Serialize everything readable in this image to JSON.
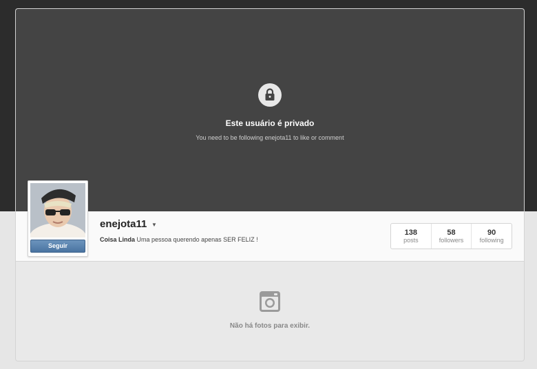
{
  "banner": {
    "title": "Este usuário é privado",
    "subtitle": "You need to be following enejota11 to like or comment"
  },
  "profile": {
    "username": "enejota11",
    "bio_name": "Coisa Linda",
    "bio_text": "Uma pessoa querendo apenas SER FELIZ !",
    "follow_label": "Seguir"
  },
  "stats": [
    {
      "value": "138",
      "label": "posts"
    },
    {
      "value": "58",
      "label": "followers"
    },
    {
      "value": "90",
      "label": "following"
    }
  ],
  "empty_state": {
    "message": "Não há fotos para exibir."
  },
  "colors": {
    "banner_bg": "#444444",
    "follow_button": "#4a74a1"
  }
}
